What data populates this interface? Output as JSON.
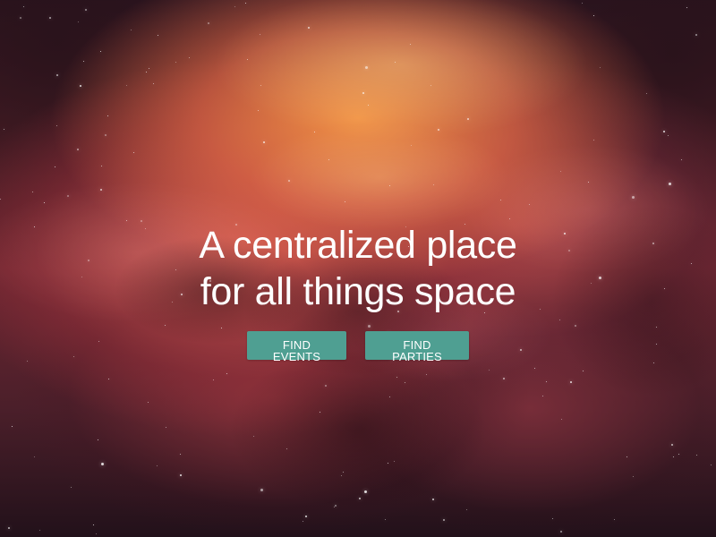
{
  "hero": {
    "title_lines": [
      "A centralized place",
      "for all things space"
    ],
    "buttons": {
      "find_events": "FIND EVENTS",
      "find_parties": "FIND PARTIES"
    },
    "colors": {
      "accent": "#4f9f92",
      "text": "#ffffff"
    }
  }
}
